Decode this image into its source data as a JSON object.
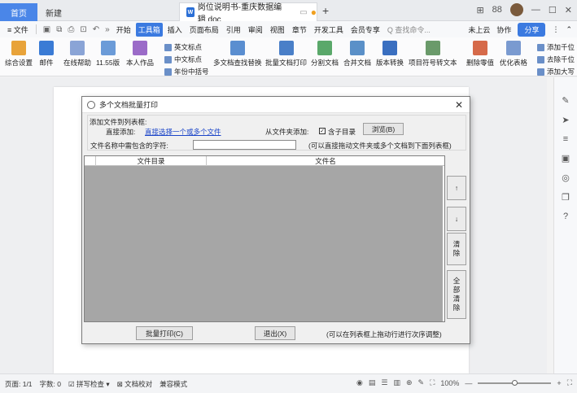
{
  "tabs": {
    "home": "首页",
    "new": "新建",
    "doc": "岗位说明书-重庆数据编辑.doc",
    "doc_icon_letter": "W",
    "plus": "+"
  },
  "window": {
    "layout_icon": "⊞",
    "grid_icon": "88",
    "minimize": "—",
    "maximize": "☐",
    "close": "✕"
  },
  "menu": {
    "file": "≡ 文件",
    "items": [
      "开始",
      "工具箱",
      "插入",
      "页面布局",
      "引用",
      "审阅",
      "视图",
      "章节",
      "开发工具",
      "会员专享"
    ],
    "active_index": 1,
    "search": "Q 查找命令...",
    "cloud": "未上云",
    "collab": "协作",
    "share": "分享"
  },
  "ribbon": {
    "big": [
      "综合设置",
      "邮件",
      "在线帮助",
      "11.55版",
      "本人作品",
      "多文档查找替换",
      "批量文档打印",
      "分割文档",
      "合并文档",
      "版本转换",
      "项目符号转文本",
      "删除零值",
      "优化表格"
    ],
    "small": [
      "英文标点",
      "中文标点",
      "年份中括号",
      "添加千位",
      "去除千位",
      "添加大写"
    ]
  },
  "dialog": {
    "title": "多个文档批量打印",
    "close": "✕",
    "group_label": "添加文件到列表框:",
    "direct_add": "直接添加:",
    "direct_link": "直接选择一个或多个文件",
    "folder_add": "从文件夹添加:",
    "include_sub": "含子目录",
    "checked_mark": "✓",
    "browse": "浏览(B)",
    "filter_label": "文件名称中需包含的字符:",
    "filter_value": "",
    "drag_hint": "(可以直接拖动文件夹或多个文档到下面列表框)",
    "columns": [
      "文件目录",
      "文件名"
    ],
    "up": "↑",
    "down": "↓",
    "clear": "清\n除",
    "clear_all": "全\n部\n清\n除",
    "print": "批量打印(C)",
    "exit": "退出(X)",
    "order_hint": "(可以在列表框上拖动行进行次序调整)"
  },
  "status": {
    "page": "页面: 1/1",
    "words": "字数: 0",
    "spell": "拼写检查",
    "proof": "文档校对",
    "compat": "兼容模式",
    "zoom": "100%",
    "zoom_level": 0.5
  }
}
